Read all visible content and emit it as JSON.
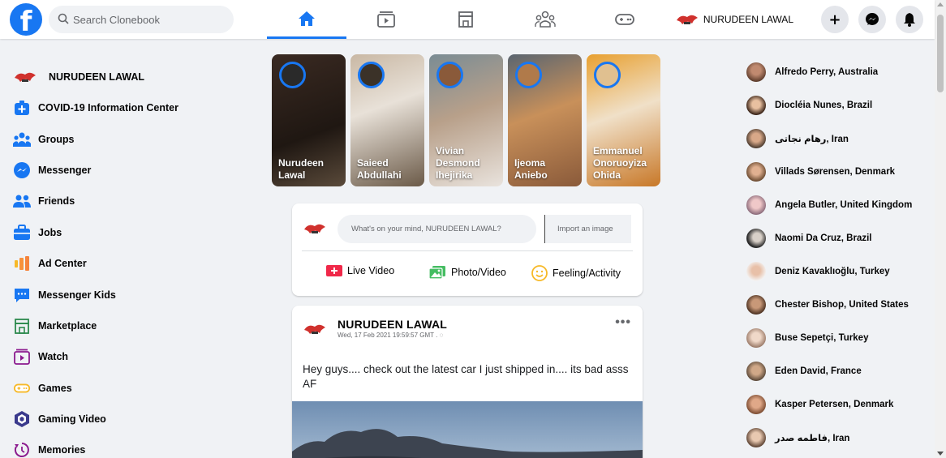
{
  "header": {
    "search_placeholder": "Search Clonebook",
    "tabs": [
      {
        "name": "home",
        "active": true
      },
      {
        "name": "watch",
        "active": false
      },
      {
        "name": "marketplace",
        "active": false
      },
      {
        "name": "groups",
        "active": false
      },
      {
        "name": "gaming",
        "active": false
      }
    ],
    "profile_name": "NURUDEEN LAWAL",
    "accent_color": "#1877f2"
  },
  "left_sidebar": {
    "profile_name": "NURUDEEN LAWAL",
    "items": [
      {
        "label": "COVID-19 Information Center",
        "icon": "covid-info-icon"
      },
      {
        "label": "Groups",
        "icon": "groups-icon"
      },
      {
        "label": "Messenger",
        "icon": "messenger-icon"
      },
      {
        "label": "Friends",
        "icon": "friends-icon"
      },
      {
        "label": "Jobs",
        "icon": "jobs-icon"
      },
      {
        "label": "Ad Center",
        "icon": "ad-center-icon"
      },
      {
        "label": "Messenger Kids",
        "icon": "messenger-kids-icon"
      },
      {
        "label": "Marketplace",
        "icon": "marketplace-icon"
      },
      {
        "label": "Watch",
        "icon": "watch-icon"
      },
      {
        "label": "Games",
        "icon": "games-icon"
      },
      {
        "label": "Gaming Video",
        "icon": "gaming-video-icon"
      },
      {
        "label": "Memories",
        "icon": "memories-icon"
      }
    ]
  },
  "stories": [
    {
      "line1": "Nurudeen",
      "line2": "Lawal"
    },
    {
      "line1": "Saieed",
      "line2": "Abdullahi"
    },
    {
      "line1": "Vivian",
      "line2": "Desmond",
      "line3": "Ihejirika"
    },
    {
      "line1": "Ijeoma",
      "line2": "Aniebo"
    },
    {
      "line1": "Emmanuel",
      "line2": "Onoruoyiza",
      "line3": "Ohida"
    }
  ],
  "composer": {
    "placeholder": "What's on your mind, NURUDEEN LAWAL?",
    "import_label": "Import an image",
    "actions": [
      {
        "label": "Live Video",
        "icon": "live-video-icon",
        "color": "#f02849"
      },
      {
        "label": "Photo/Video",
        "icon": "photo-video-icon",
        "color": "#45bd62"
      },
      {
        "label": "Feeling/Activity",
        "icon": "feeling-activity-icon",
        "color": "#f7b928"
      }
    ]
  },
  "post": {
    "author": "NURUDEEN LAWAL",
    "date": "Wed, 17 Feb 2021 19:59:57 GMT .",
    "more": "•••",
    "text": "Hey guys.... check out the latest car I just shipped in.... its bad asss AF"
  },
  "contacts": [
    "Alfredo Perry, Australia",
    "Diocléia Nunes, Brazil",
    "رهام نجاتی, Iran",
    "Villads Sørensen, Denmark",
    "Angela Butler, United Kingdom",
    "Naomi Da Cruz, Brazil",
    "Deniz Kavaklıoğlu, Turkey",
    "Chester Bishop, United States",
    "Buse Sepetçi, Turkey",
    "Eden David, France",
    "Kasper Petersen, Denmark",
    "فاطمه صدر, Iran"
  ]
}
